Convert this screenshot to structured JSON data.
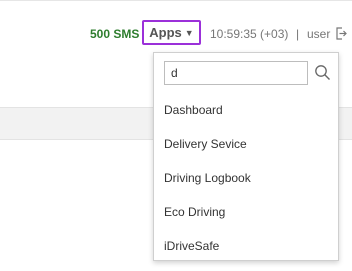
{
  "header": {
    "sms_text": "500 SMS",
    "sms_color": "#2e7d2e",
    "apps_label": "Apps",
    "apps_border_color": "#9b30d9",
    "time": "10:59:35 (+03)",
    "separator": "|",
    "user": "user",
    "logout_icon": "logout-icon"
  },
  "apps_dropdown": {
    "search": {
      "value": "d",
      "icon": "search-icon"
    },
    "items": [
      {
        "label": "Dashboard"
      },
      {
        "label": "Delivery Sevice"
      },
      {
        "label": "Driving Logbook"
      },
      {
        "label": "Eco Driving"
      },
      {
        "label": "iDriveSafe"
      }
    ]
  }
}
